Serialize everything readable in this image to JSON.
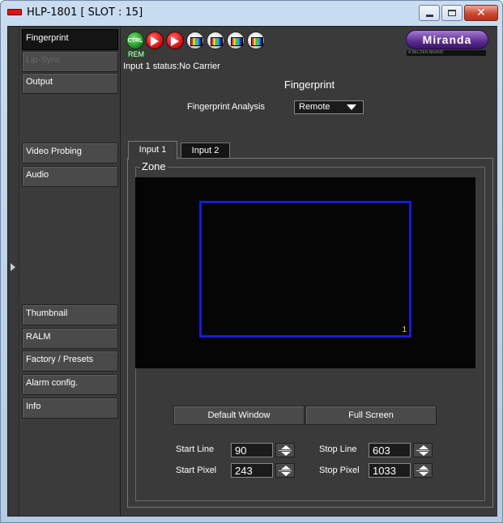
{
  "window": {
    "title": "HLP-1801 [ SLOT : 15]",
    "minimize": "–",
    "maximize": "□",
    "close": "✕"
  },
  "sidebar": {
    "items": [
      {
        "label": "Fingerprint",
        "state": "active"
      },
      {
        "label": "Lip-Sync",
        "state": "disabled"
      },
      {
        "label": "Output",
        "state": "normal"
      },
      {
        "label": "Video Probing",
        "state": "normal"
      },
      {
        "label": "Audio",
        "state": "normal"
      },
      {
        "label": "Thumbnail",
        "state": "normal"
      },
      {
        "label": "RALM",
        "state": "normal"
      },
      {
        "label": "Factory / Presets",
        "state": "normal"
      },
      {
        "label": "Alarm config.",
        "state": "normal"
      },
      {
        "label": "Info",
        "state": "normal"
      }
    ]
  },
  "toolbar": {
    "ctrl_label": "CTRL",
    "rem_label": "REM",
    "icons": [
      "ctrl-icon",
      "route-arrow-icon",
      "route-arrow-icon",
      "signal-probe-icon",
      "video-probe-icon",
      "video-probe-icon",
      "color-bars-icon"
    ]
  },
  "brand": {
    "name": "Miranda",
    "tagline": "A BELDEN BRAND"
  },
  "status": {
    "text": "Input 1 status:No Carrier"
  },
  "page": {
    "title": "Fingerprint",
    "analysis_label": "Fingerprint Analysis",
    "analysis_value": "Remote"
  },
  "tabs": [
    {
      "label": "Input 1",
      "selected": true
    },
    {
      "label": "Input 2",
      "selected": false
    }
  ],
  "zone": {
    "legend": "Zone",
    "window_index": "1",
    "rect_color": "#1a1ad6"
  },
  "buttons": {
    "default_window": "Default Window",
    "full_screen": "Full Screen"
  },
  "fields": {
    "start_line_label": "Start Line",
    "start_line_value": "90",
    "start_pixel_label": "Start Pixel",
    "start_pixel_value": "243",
    "stop_line_label": "Stop Line",
    "stop_line_value": "603",
    "stop_pixel_label": "Stop Pixel",
    "stop_pixel_value": "1033"
  }
}
